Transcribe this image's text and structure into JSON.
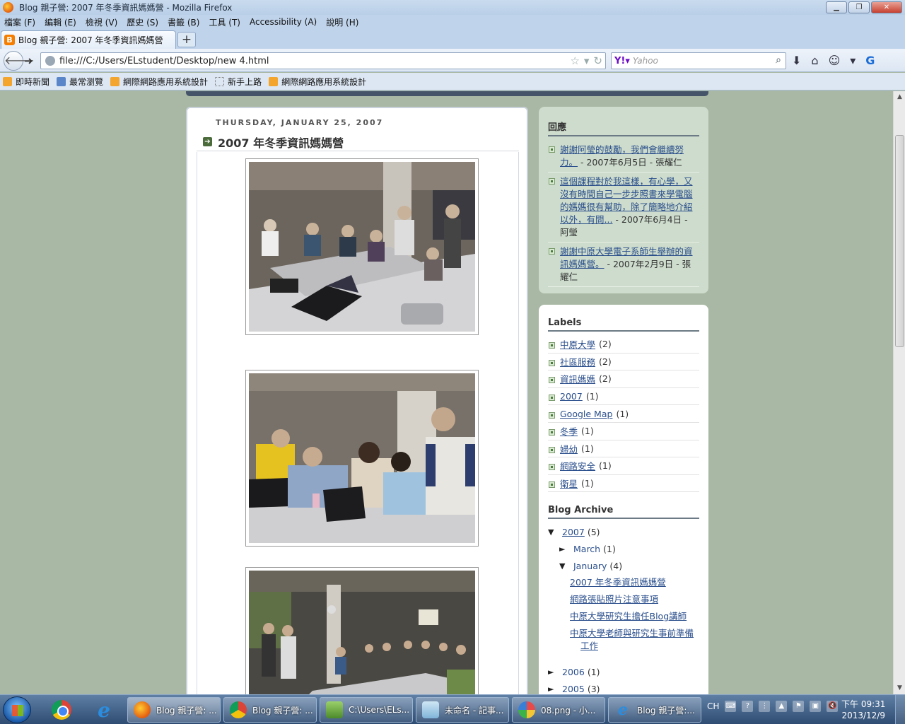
{
  "window": {
    "title": "Blog 親子營: 2007 年冬季資訊媽媽營 - Mozilla Firefox"
  },
  "menu": [
    "檔案 (F)",
    "編輯 (E)",
    "檢視 (V)",
    "歷史 (S)",
    "書籤 (B)",
    "工具 (T)",
    "Accessibility (A)",
    "說明 (H)"
  ],
  "tab": {
    "label": "Blog 親子營: 2007 年冬季資訊媽媽營",
    "new_tab": "+"
  },
  "nav": {
    "url": "file:///C:/Users/ELstudent/Desktop/new  4.html",
    "search_placeholder": "Yahoo"
  },
  "bookmarks": [
    {
      "label": "即時新聞",
      "icon": "rss-icon"
    },
    {
      "label": "最常瀏覽",
      "icon": "page-icon"
    },
    {
      "label": "網際網路應用系統設計",
      "icon": "rss-icon"
    },
    {
      "label": "新手上路",
      "icon": "dotted-page-icon"
    },
    {
      "label": "網際網路應用系統設計",
      "icon": "rss-icon"
    }
  ],
  "post": {
    "date": "THURSDAY, JANUARY 25, 2007",
    "title": "2007 年冬季資訊媽媽營"
  },
  "comments": {
    "heading": "回應",
    "items": [
      {
        "link": "謝謝阿瑩的鼓勵，我們會繼續努力。",
        "meta": " - 2007年6月5日 - 張耀仁"
      },
      {
        "link": "這個課程對於我這樣，有心學，又沒有時間自己一步步照書來學電腦的媽媽很有幫助，除了簡略地介紹以外，有問...",
        "meta": " - 2007年6月4日 - 阿瑩"
      },
      {
        "link": "謝謝中原大學電子系師生舉辦的資訊媽媽營。",
        "meta": " - 2007年2月9日 - 張耀仁"
      }
    ]
  },
  "labels": {
    "heading": "Labels",
    "items": [
      {
        "name": "中原大學",
        "count": "(2)"
      },
      {
        "name": "社區服務",
        "count": "(2)"
      },
      {
        "name": "資訊媽媽",
        "count": "(2)"
      },
      {
        "name": "2007",
        "count": "(1)"
      },
      {
        "name": "Google Map",
        "count": "(1)"
      },
      {
        "name": "冬季",
        "count": "(1)"
      },
      {
        "name": "婦幼",
        "count": "(1)"
      },
      {
        "name": "網路安全",
        "count": "(1)"
      },
      {
        "name": "衛星",
        "count": "(1)"
      }
    ]
  },
  "archive": {
    "heading": "Blog Archive",
    "y2007": {
      "year": "2007",
      "count": "(5)",
      "toggle": "▼"
    },
    "march": {
      "month": "March",
      "count": "(1)",
      "toggle": "►"
    },
    "january": {
      "month": "January",
      "count": "(4)",
      "toggle": "▼"
    },
    "posts": [
      "2007 年冬季資訊媽媽營",
      "網路張貼照片注意事項",
      "中原大學研究生擔任Blog講師",
      "中原大學老師與研究生事前準備工作"
    ],
    "y2006": {
      "year": "2006",
      "count": "(1)",
      "toggle": "►"
    },
    "y2005": {
      "year": "2005",
      "count": "(3)",
      "toggle": "►"
    }
  },
  "taskbar": {
    "tasks": [
      {
        "label": "Blog 親子營: ...",
        "icon": "firefox-icon"
      },
      {
        "label": "Blog 親子營: ...",
        "icon": "chrome-icon"
      },
      {
        "label": "C:\\Users\\ELs...",
        "icon": "notepadpp-icon"
      },
      {
        "label": "未命名 - 記事...",
        "icon": "notepad-icon"
      },
      {
        "label": "08.png - 小...",
        "icon": "paint-icon"
      },
      {
        "label": "Blog 親子營:...",
        "icon": "ie-icon"
      }
    ],
    "lang": "CH",
    "time": "下午 09:31",
    "date": "2013/12/9"
  }
}
